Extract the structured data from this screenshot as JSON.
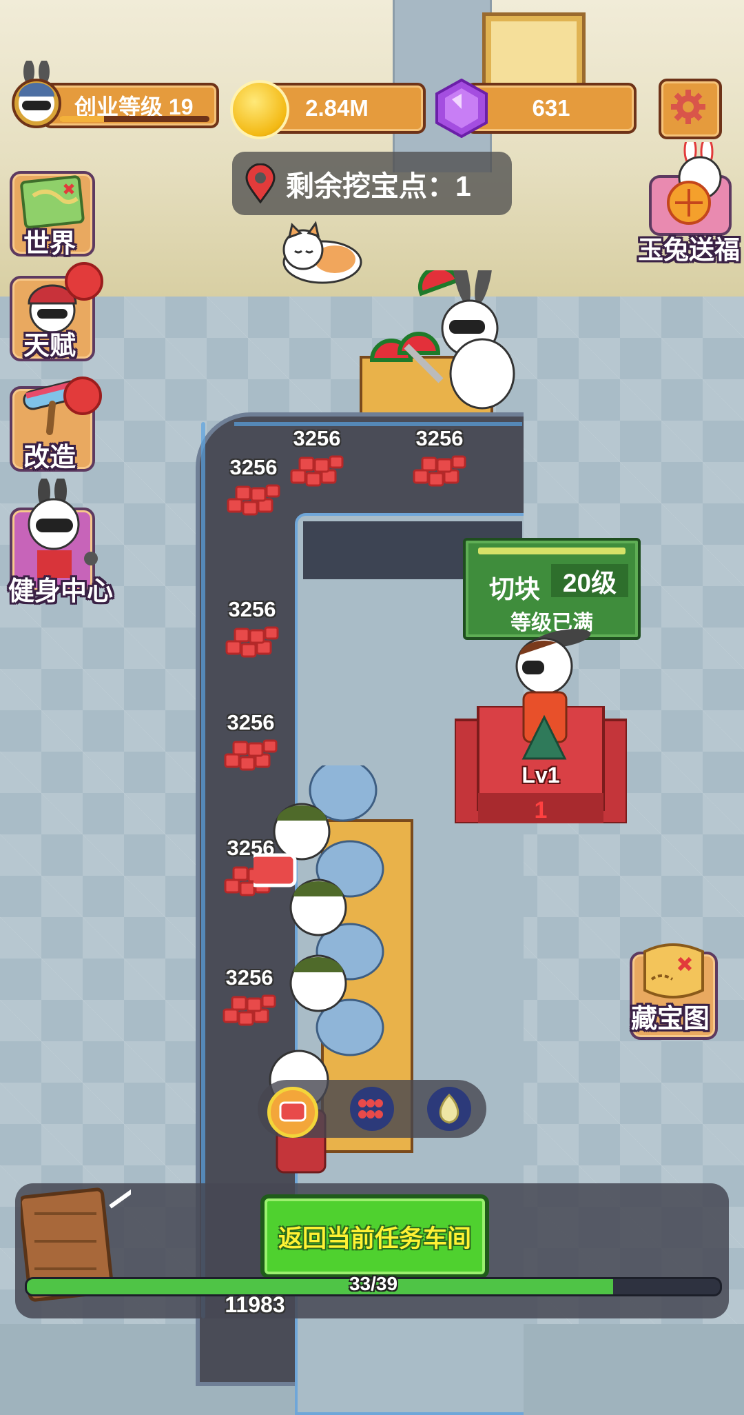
{
  "top_bar": {
    "level_label": "创业等级 19",
    "level_progress": 0.3,
    "coins": "2.84M",
    "gems": "631"
  },
  "dig_banner": {
    "text": "剩余挖宝点：1"
  },
  "side_menu": {
    "world": "世界",
    "talent": "天赋",
    "modify": "改造",
    "gym": "健身中心"
  },
  "jade_rabbit": {
    "label": "玉兔送福"
  },
  "conveyor": {
    "items": [
      {
        "count": "3256"
      },
      {
        "count": "3256"
      },
      {
        "count": "3256"
      },
      {
        "count": "3256"
      },
      {
        "count": "3256"
      },
      {
        "count": "3256"
      },
      {
        "count": "3256"
      }
    ]
  },
  "station": {
    "name": "切块",
    "level": "20级",
    "status": "等级已满",
    "worker_level": "Lv1",
    "worker_count": "1"
  },
  "treasure_map": {
    "label": "藏宝图"
  },
  "products": [
    "meat-block-icon",
    "skewer-icon",
    "dumpling-icon"
  ],
  "bottom": {
    "return_button": "返回当前任务车间",
    "progress_text": "33/39",
    "progress_value": 0.846,
    "counter": "11983"
  },
  "colors": {
    "panel_orange": "#e59b3d",
    "button_green": "#4fd12f",
    "station_green": "#3f8d3c"
  }
}
